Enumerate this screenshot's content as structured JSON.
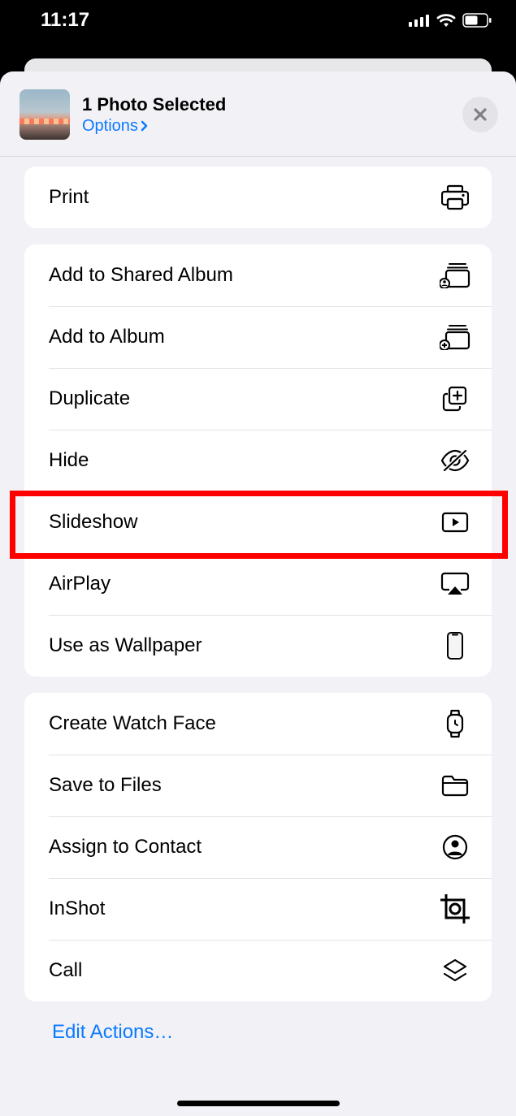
{
  "statusBar": {
    "time": "11:17"
  },
  "header": {
    "title": "1 Photo Selected",
    "options": "Options"
  },
  "groups": [
    {
      "rows": [
        {
          "id": "print",
          "label": "Print",
          "icon": "printer-icon"
        }
      ]
    },
    {
      "rows": [
        {
          "id": "add-shared-album",
          "label": "Add to Shared Album",
          "icon": "shared-album-icon"
        },
        {
          "id": "add-album",
          "label": "Add to Album",
          "icon": "album-plus-icon"
        },
        {
          "id": "duplicate",
          "label": "Duplicate",
          "icon": "duplicate-icon"
        },
        {
          "id": "hide",
          "label": "Hide",
          "icon": "eye-slash-icon"
        },
        {
          "id": "slideshow",
          "label": "Slideshow",
          "icon": "play-box-icon"
        },
        {
          "id": "airplay",
          "label": "AirPlay",
          "icon": "airplay-icon"
        },
        {
          "id": "wallpaper",
          "label": "Use as Wallpaper",
          "icon": "phone-icon"
        }
      ]
    },
    {
      "rows": [
        {
          "id": "watch-face",
          "label": "Create Watch Face",
          "icon": "watch-icon"
        },
        {
          "id": "save-files",
          "label": "Save to Files",
          "icon": "folder-icon"
        },
        {
          "id": "assign-contact",
          "label": "Assign to Contact",
          "icon": "contact-icon"
        },
        {
          "id": "inshot",
          "label": "InShot",
          "icon": "inshot-icon"
        },
        {
          "id": "call",
          "label": "Call",
          "icon": "layers-icon"
        }
      ]
    }
  ],
  "footer": {
    "editActions": "Edit Actions…"
  },
  "highlightedRow": "hide"
}
